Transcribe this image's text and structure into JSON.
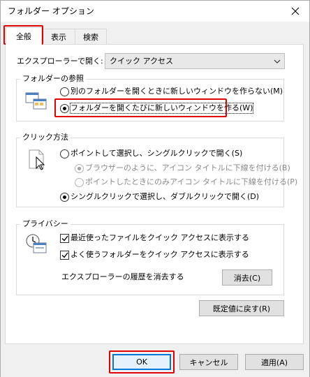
{
  "window": {
    "title": "フォルダー オプション"
  },
  "tabs": [
    {
      "label": "全般"
    },
    {
      "label": "表示"
    },
    {
      "label": "検索"
    }
  ],
  "open_explorer": {
    "label": "エクスプローラーで開く:",
    "value": "クイック アクセス"
  },
  "browse_folders": {
    "title": "フォルダーの参照",
    "options": [
      {
        "label": "別のフォルダーを開くときに新しいウィンドウを作らない(M)",
        "checked": false
      },
      {
        "label": "フォルダーを開くたびに新しいウィンドウを作る(W)",
        "checked": true
      }
    ]
  },
  "click_method": {
    "title": "クリック方法",
    "options": [
      {
        "label": "ポイントして選択し、シングルクリックで開く(S)",
        "checked": false
      },
      {
        "label": "ブラウザーのように、アイコン タイトルに下線を付ける(B)",
        "checked": true,
        "disabled": true
      },
      {
        "label": "ポイントしたときにのみアイコン タイトルに下線を付ける(P)",
        "checked": false,
        "disabled": true
      },
      {
        "label": "シングルクリックで選択し、ダブルクリックで開く(D)",
        "checked": true
      }
    ]
  },
  "privacy": {
    "title": "プライバシー",
    "options": [
      {
        "label": "最近使ったファイルをクイック アクセスに表示する",
        "checked": true
      },
      {
        "label": "よく使うフォルダーをクイック アクセスに表示する",
        "checked": true
      }
    ],
    "clear_history_label": "エクスプローラーの履歴を消去する",
    "clear_button": "消去(C)"
  },
  "restore_defaults_button": "既定値に戻す(R)",
  "footer": {
    "ok": "OK",
    "cancel": "キャンセル",
    "apply": "適用(A)"
  },
  "highlight_color": "#e00000"
}
